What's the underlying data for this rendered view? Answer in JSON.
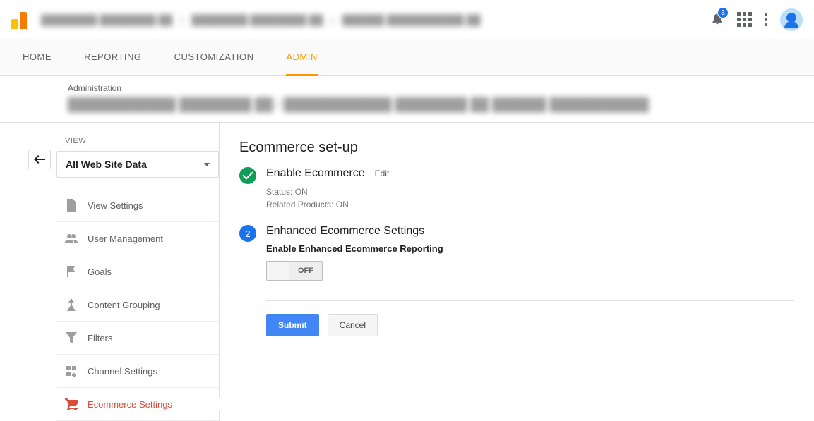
{
  "header": {
    "notif_count": "3"
  },
  "tabs": [
    "HOME",
    "REPORTING",
    "CUSTOMIZATION",
    "ADMIN"
  ],
  "active_tab": 3,
  "subhead": {
    "label": "Administration"
  },
  "sidebar": {
    "view_label": "VIEW",
    "dropdown": "All Web Site Data",
    "items": [
      {
        "label": "View Settings"
      },
      {
        "label": "User Management"
      },
      {
        "label": "Goals"
      },
      {
        "label": "Content Grouping"
      },
      {
        "label": "Filters"
      },
      {
        "label": "Channel Settings"
      },
      {
        "label": "Ecommerce Settings"
      }
    ]
  },
  "main": {
    "title": "Ecommerce set-up",
    "step1": {
      "title": "Enable Ecommerce",
      "edit": "Edit",
      "status_label": "Status:",
      "status_value": "ON",
      "related_label": "Related Products:",
      "related_value": "ON"
    },
    "step2": {
      "num": "2",
      "title": "Enhanced Ecommerce Settings",
      "subtitle": "Enable Enhanced Ecommerce Reporting",
      "toggle": "OFF"
    },
    "submit": "Submit",
    "cancel": "Cancel"
  }
}
